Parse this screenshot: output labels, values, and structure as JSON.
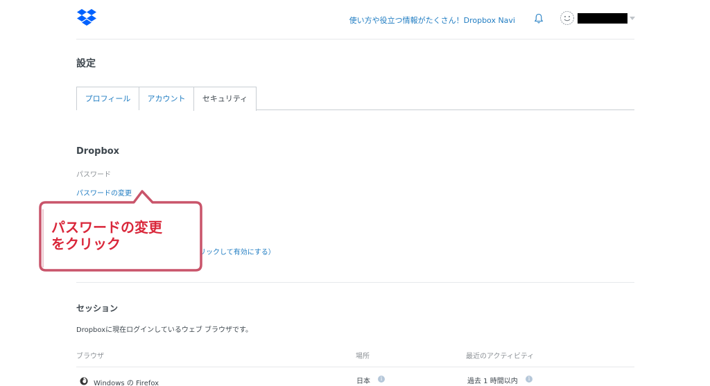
{
  "header": {
    "navi_link": "使い方や役立つ情報がたくさん！Dropbox Navi",
    "logo_icon": "dropbox-logo",
    "bell_icon": "bell-icon",
    "avatar_icon": "smiley-avatar",
    "accent_color": "#1f7cc2"
  },
  "page": {
    "title": "設定"
  },
  "tabs": [
    {
      "label": "プロフィール",
      "active": false
    },
    {
      "label": "アカウント",
      "active": false
    },
    {
      "label": "セキュリティ",
      "active": true
    }
  ],
  "dropbox_section": {
    "title": "Dropbox",
    "password_label": "パスワード",
    "password_change_link": "パスワードの変更",
    "two_step_link": "リックして有効にする）"
  },
  "callout": {
    "line1": "パスワードの変更",
    "line2": "をクリック",
    "border_color": "#c9546a",
    "text_color": "#d9273a"
  },
  "sessions": {
    "title": "セッション",
    "description": "Dropboxに現在ログインしているウェブ ブラウザです。",
    "columns": {
      "browser": "ブラウザ",
      "location": "場所",
      "activity": "最近のアクティビティ"
    },
    "rows": [
      {
        "browser": "Windows の Firefox",
        "location": "日本",
        "activity": "過去 1 時間以内"
      }
    ]
  }
}
